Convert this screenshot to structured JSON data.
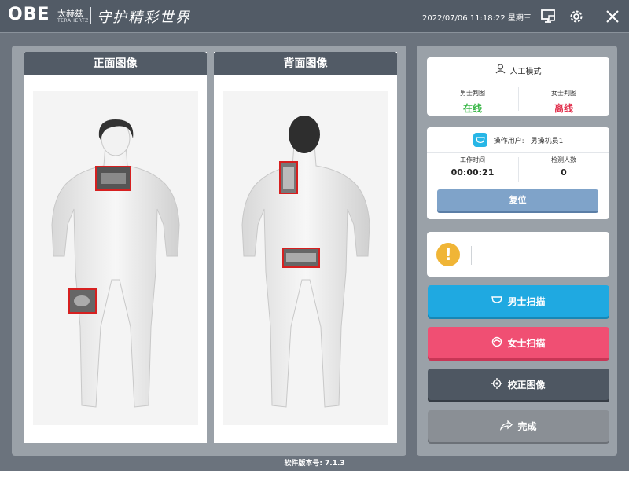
{
  "header": {
    "logo": "OBE",
    "logo_cn": "太赫兹",
    "logo_en": "TERAHERTZ",
    "slogan": "守护精彩世界",
    "datetime": "2022/07/06 11:18:22 星期三"
  },
  "panels": {
    "front_title": "正面图像",
    "back_title": "背面图像"
  },
  "mode": {
    "title": "人工模式",
    "male_label": "男士判图",
    "male_status": "在线",
    "female_label": "女士判图",
    "female_status": "离线"
  },
  "operator": {
    "label": "操作用户:",
    "name": "男操机员1",
    "work_time_label": "工作时间",
    "work_time": "00:00:21",
    "count_label": "检测人数",
    "count": "0",
    "reset_label": "复位"
  },
  "buttons": {
    "male_scan": "男士扫描",
    "female_scan": "女士扫描",
    "calibrate": "校正图像",
    "finish": "完成"
  },
  "footer": {
    "version": "软件版本号: 7.1.3"
  },
  "colors": {
    "online": "#3cb84a",
    "offline": "#e2334f",
    "male_scan": "#1fa9e1",
    "female_scan": "#f04f73",
    "calibrate": "#4e5762",
    "finish": "#8a8f95",
    "reset": "#7fa3c9",
    "warning": "#f0b536"
  },
  "icons": {
    "header": [
      "monitor-icon",
      "gear-icon",
      "close-icon"
    ],
    "mode": "person-icon",
    "operator": "mask-icon",
    "warning": "exclamation-icon",
    "male_scan": "mask-icon",
    "female_scan": "female-head-icon",
    "calibrate": "crosshair-icon",
    "finish": "share-arrow-icon"
  }
}
